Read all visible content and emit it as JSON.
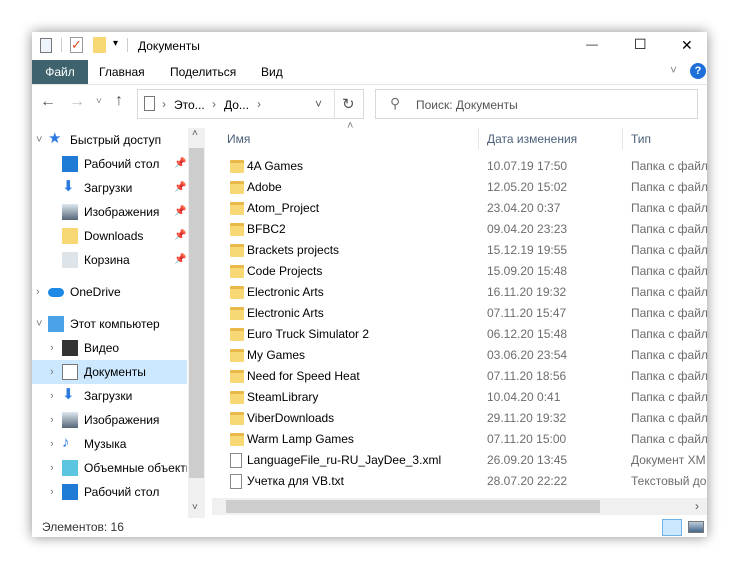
{
  "window": {
    "title": "Документы",
    "minimize": "—",
    "maximize": "☐",
    "close": "✕"
  },
  "ribbon": {
    "tabs": [
      "Файл",
      "Главная",
      "Поделиться",
      "Вид"
    ]
  },
  "address": {
    "crumbs": [
      "Это...",
      "До..."
    ]
  },
  "search": {
    "placeholder": "Поиск: Документы"
  },
  "sidebar": {
    "items": [
      {
        "label": "Быстрый доступ",
        "icon": "star-icon",
        "level": 0,
        "chevron": "˅"
      },
      {
        "label": "Рабочий стол",
        "icon": "desktop-icon",
        "level": 1,
        "pinned": true
      },
      {
        "label": "Загрузки",
        "icon": "download-icon",
        "level": 1,
        "pinned": true
      },
      {
        "label": "Изображения",
        "icon": "pictures-icon",
        "level": 1,
        "pinned": true
      },
      {
        "label": "Downloads",
        "icon": "folder-icon",
        "level": 1,
        "pinned": true
      },
      {
        "label": "Корзина",
        "icon": "recycle-bin-icon",
        "level": 1,
        "pinned": true
      },
      {
        "label": "OneDrive",
        "icon": "cloud-icon",
        "level": 0,
        "chevron": "›"
      },
      {
        "label": "Этот компьютер",
        "icon": "computer-icon",
        "level": 0,
        "chevron": "˅"
      },
      {
        "label": "Видео",
        "icon": "video-icon",
        "level": 1,
        "chevron": "›"
      },
      {
        "label": "Документы",
        "icon": "documents-icon",
        "level": 1,
        "chevron": "›",
        "selected": true
      },
      {
        "label": "Загрузки",
        "icon": "download-icon",
        "level": 1,
        "chevron": "›"
      },
      {
        "label": "Изображения",
        "icon": "pictures-icon",
        "level": 1,
        "chevron": "›"
      },
      {
        "label": "Музыка",
        "icon": "music-icon",
        "level": 1,
        "chevron": "›"
      },
      {
        "label": "Объемные объекты",
        "icon": "3d-objects-icon",
        "level": 1,
        "chevron": "›"
      },
      {
        "label": "Рабочий стол",
        "icon": "desktop-icon",
        "level": 1,
        "chevron": "›"
      }
    ]
  },
  "columns": {
    "name": "Имя",
    "date": "Дата изменения",
    "type": "Тип"
  },
  "files": [
    {
      "name": "4A Games",
      "date": "10.07.19 17:50",
      "type": "Папка с файл",
      "kind": "folder"
    },
    {
      "name": "Adobe",
      "date": "12.05.20 15:02",
      "type": "Папка с файл",
      "kind": "folder"
    },
    {
      "name": "Atom_Project",
      "date": "23.04.20 0:37",
      "type": "Папка с файл",
      "kind": "folder"
    },
    {
      "name": "BFBC2",
      "date": "09.04.20 23:23",
      "type": "Папка с файл",
      "kind": "folder"
    },
    {
      "name": "Brackets projects",
      "date": "15.12.19 19:55",
      "type": "Папка с файл",
      "kind": "folder"
    },
    {
      "name": "Code Projects",
      "date": "15.09.20 15:48",
      "type": "Папка с файл",
      "kind": "folder"
    },
    {
      "name": "Electronic Arts",
      "date": "16.11.20 19:32",
      "type": "Папка с файл",
      "kind": "folder"
    },
    {
      "name": "Electronic Arts",
      "date": "07.11.20 15:47",
      "type": "Папка с файл",
      "kind": "folder"
    },
    {
      "name": "Euro Truck Simulator 2",
      "date": "06.12.20 15:48",
      "type": "Папка с файл",
      "kind": "folder"
    },
    {
      "name": "My Games",
      "date": "03.06.20 23:54",
      "type": "Папка с файл",
      "kind": "folder"
    },
    {
      "name": "Need for Speed Heat",
      "date": "07.11.20 18:56",
      "type": "Папка с файл",
      "kind": "folder"
    },
    {
      "name": "SteamLibrary",
      "date": "10.04.20 0:41",
      "type": "Папка с файл",
      "kind": "folder"
    },
    {
      "name": "ViberDownloads",
      "date": "29.11.20 19:32",
      "type": "Папка с файл",
      "kind": "folder"
    },
    {
      "name": "Warm Lamp Games",
      "date": "07.11.20 15:00",
      "type": "Папка с файл",
      "kind": "folder"
    },
    {
      "name": "LanguageFile_ru-RU_JayDee_3.xml",
      "date": "26.09.20 13:45",
      "type": "Документ XM",
      "kind": "xml"
    },
    {
      "name": "Учетка для VB.txt",
      "date": "28.07.20 22:22",
      "type": "Текстовый до",
      "kind": "txt"
    }
  ],
  "status": {
    "count": "Элементов: 16"
  },
  "colors": {
    "file_tab": "#3e636e",
    "selected": "#cce8ff",
    "folder": "#f8d775",
    "help": "#1e6fd9"
  }
}
